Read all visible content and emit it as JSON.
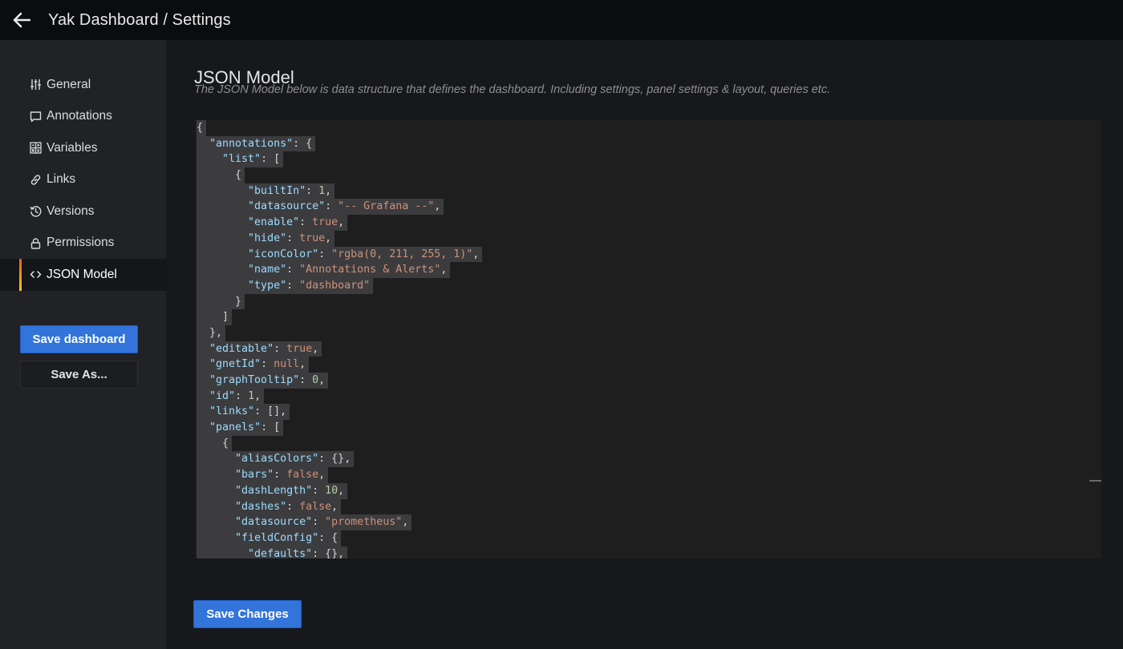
{
  "topbar": {
    "title": "Yak Dashboard / Settings"
  },
  "sidebar": {
    "items": [
      {
        "label": "General",
        "icon": "sliders-icon",
        "active": false
      },
      {
        "label": "Annotations",
        "icon": "comment-icon",
        "active": false
      },
      {
        "label": "Variables",
        "icon": "calculator-icon",
        "active": false
      },
      {
        "label": "Links",
        "icon": "link-icon",
        "active": false
      },
      {
        "label": "Versions",
        "icon": "history-icon",
        "active": false
      },
      {
        "label": "Permissions",
        "icon": "lock-icon",
        "active": false
      },
      {
        "label": "JSON Model",
        "icon": "code-icon",
        "active": true
      }
    ],
    "save_dashboard_label": "Save dashboard",
    "save_as_label": "Save As..."
  },
  "main": {
    "title": "JSON Model",
    "description": "The JSON Model below is data structure that defines the dashboard. Including settings, panel settings & layout, queries etc.",
    "save_changes_label": "Save Changes",
    "code_lines": [
      "{",
      "  \"annotations\": {",
      "    \"list\": [",
      "      {",
      "        \"builtIn\": 1,",
      "        \"datasource\": \"-- Grafana --\",",
      "        \"enable\": true,",
      "        \"hide\": true,",
      "        \"iconColor\": \"rgba(0, 211, 255, 1)\",",
      "        \"name\": \"Annotations & Alerts\",",
      "        \"type\": \"dashboard\"",
      "      }",
      "    ]",
      "  },",
      "  \"editable\": true,",
      "  \"gnetId\": null,",
      "  \"graphTooltip\": 0,",
      "  \"id\": 1,",
      "  \"links\": [],",
      "  \"panels\": [",
      "    {",
      "      \"aliasColors\": {},",
      "      \"bars\": false,",
      "      \"dashLength\": 10,",
      "      \"dashes\": false,",
      "      \"datasource\": \"prometheus\",",
      "      \"fieldConfig\": {",
      "        \"defaults\": {},"
    ]
  },
  "colors": {
    "accent": "#3274d9",
    "active_bar_start": "#f05a28",
    "active_bar_end": "#fbca0a",
    "json_key": "#9cdcfe",
    "json_string": "#ce9178",
    "json_number": "#b5cea8"
  }
}
